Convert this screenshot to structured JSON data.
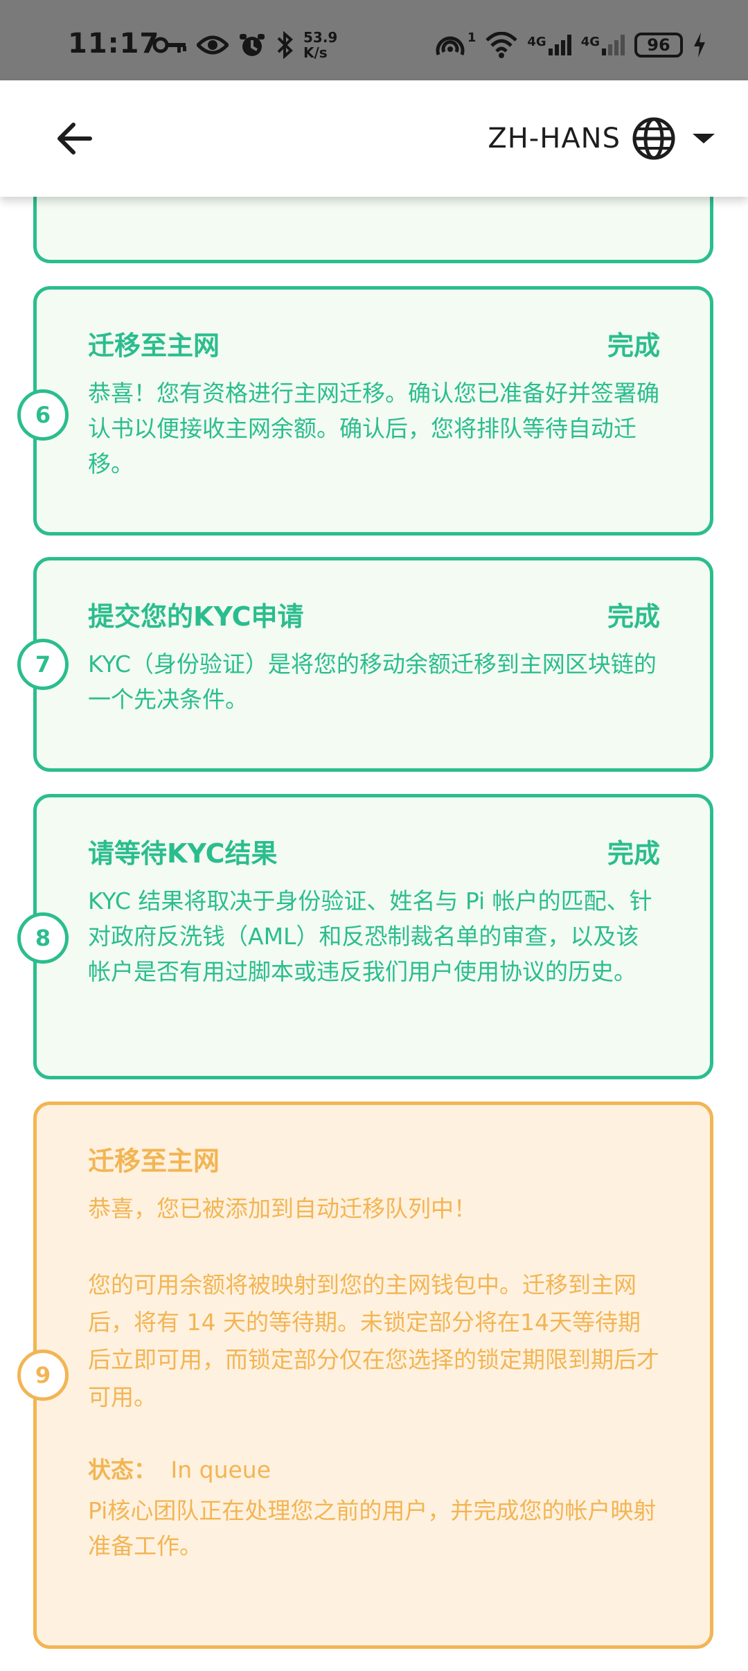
{
  "statusbar": {
    "time": "11:17",
    "speed_value": "53.9",
    "speed_unit": "K/s",
    "net1": "4G",
    "net2": "4G",
    "hotspot_count": "1",
    "battery": "96"
  },
  "appbar": {
    "language": "ZH-HANS"
  },
  "steps": [
    {
      "number": "6",
      "title": "迁移至主网",
      "status": "完成",
      "desc": "恭喜！您有资格进行主网迁移。确认您已准备好并签署确认书以便接收主网余额。确认后，您将排队等待自动迁移。"
    },
    {
      "number": "7",
      "title": "提交您的KYC申请",
      "status": "完成",
      "desc": "KYC（身份验证）是将您的移动余额迁移到主网区块链的一个先决条件。"
    },
    {
      "number": "8",
      "title": "请等待KYC结果",
      "status": "完成",
      "desc": "KYC 结果将取决于身份验证、姓名与 Pi 帐户的匹配、针对政府反洗钱（AML）和反恐制裁名单的审查，以及该帐户是否有用过脚本或违反我们用户使用协议的历史。"
    },
    {
      "number": "9",
      "title": "迁移至主网",
      "desc1": "恭喜，您已被添加到自动迁移队列中！",
      "desc2": "您的可用余额将被映射到您的主网钱包中。迁移到主网后，将有 14 天的等待期。未锁定部分将在14天等待期后立即可用，而锁定部分仅在您选择的锁定期限到期后才可用。",
      "status_label": "状态：",
      "status_value": "In queue",
      "desc3": "Pi核心团队正在处理您之前的用户，并完成您的帐户映射准备工作。"
    }
  ],
  "colors": {
    "done": "#2bbd8e",
    "pending": "#f2b554",
    "done_bg": "#f3fbf3",
    "pending_bg": "#fff1df"
  }
}
